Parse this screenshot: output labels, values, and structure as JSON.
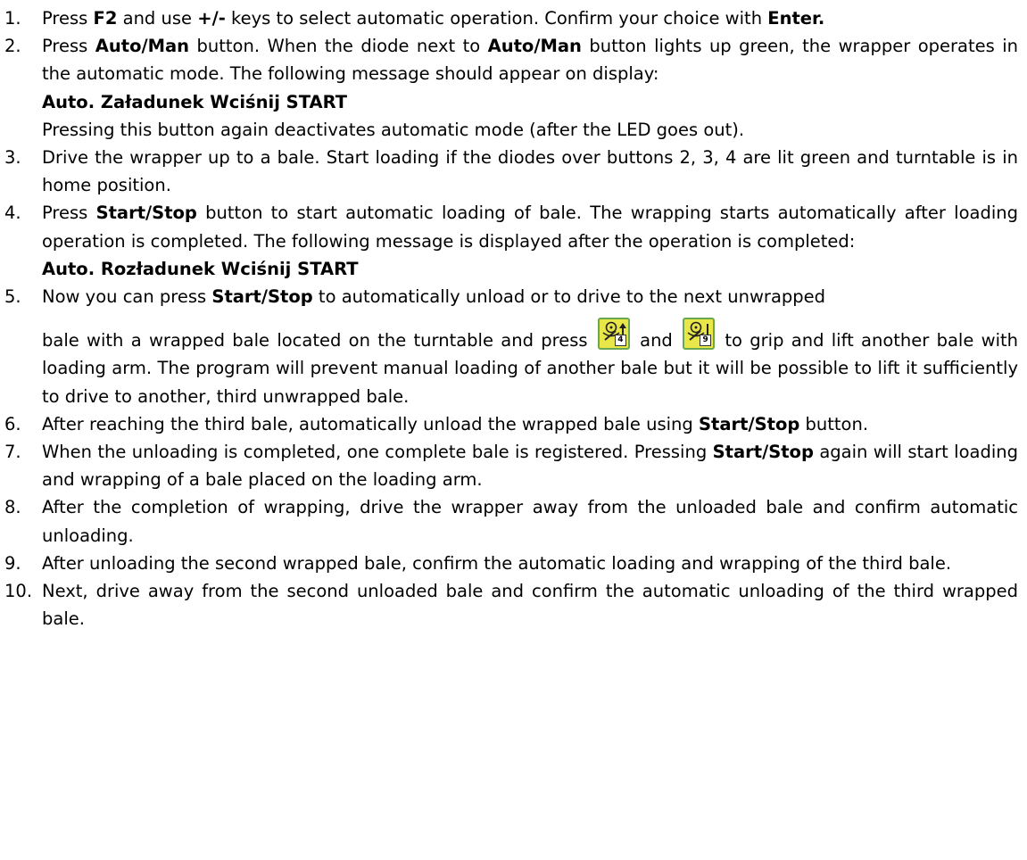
{
  "steps": [
    {
      "n": "1.",
      "parts": [
        "Press ",
        "F2",
        " and use ",
        "+/-",
        " keys to select automatic operation. Confirm your choice with ",
        "Enter."
      ]
    },
    {
      "n": "2.",
      "parts": [
        "Press ",
        "Auto/Man",
        " button. When the diode next to ",
        "Auto/Man",
        " button lights up green, the wrapper operates in the automatic mode. The following message should appear on display:"
      ],
      "msg": "Auto. Załadunek Wciśnij START",
      "after": "Pressing this button again deactivates automatic mode (after the LED goes out)."
    },
    {
      "n": "3.",
      "text": "Drive the wrapper up to a bale. Start loading if the diodes over buttons 2, 3, 4 are lit green and turntable is in home position."
    },
    {
      "n": "4.",
      "parts": [
        "Press ",
        "Start/Stop",
        " button to start automatic loading of bale. The wrapping starts automatically after loading operation is completed. The following message is displayed after the operation is completed:"
      ],
      "msg": "Auto. Rozładunek Wciśnij START"
    },
    {
      "n": "5.",
      "parts": [
        "Now you can press ",
        "Start/Stop",
        " to automatically unload or to drive to the next unwrapped"
      ],
      "cont": [
        "bale with a wrapped bale located on the turntable and press ",
        " and ",
        " to grip and lift another bale with loading arm. The program will prevent manual loading of another bale but it will be possible to lift it sufficiently to drive to another, third unwrapped bale."
      ],
      "icons": [
        {
          "name": "loading-arm-key-icon",
          "num": "4"
        },
        {
          "name": "loading-arm-key-icon",
          "num": "9"
        }
      ]
    },
    {
      "n": "6.",
      "parts": [
        "After reaching the third bale, automatically unload the wrapped bale using ",
        "Start/Stop",
        " button."
      ]
    },
    {
      "n": "7.",
      "parts": [
        "When the unloading is completed, one complete bale is registered. Pressing ",
        "Start/Stop",
        " again will start loading and wrapping of a bale placed on the loading arm."
      ]
    },
    {
      "n": "8.",
      "text": "After the completion of wrapping, drive the wrapper away from the unloaded bale and confirm automatic unloading."
    },
    {
      "n": "9.",
      "text": "After unloading the second wrapped bale, confirm the automatic loading and wrapping of the third bale."
    },
    {
      "n": "10.",
      "text": "Next, drive away from the second unloaded bale and confirm the automatic unloading of the third wrapped bale."
    }
  ],
  "colors": {
    "icon_fill": "#e9e64a",
    "icon_border": "#6aa84f"
  }
}
